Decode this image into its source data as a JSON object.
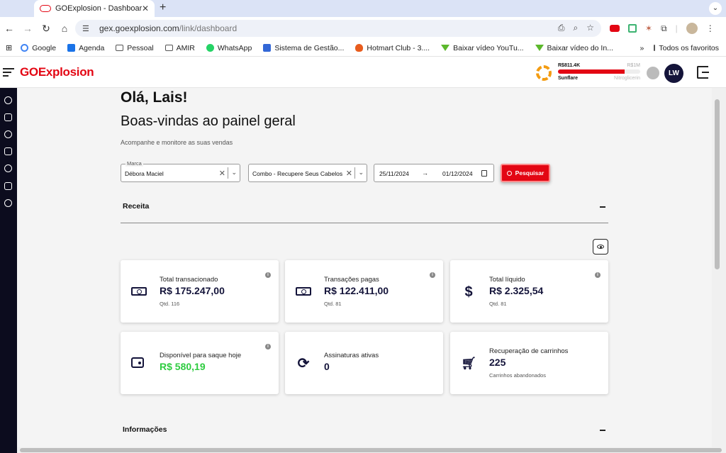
{
  "browser": {
    "tab_title": "GOExplosion - Dashboard",
    "url_host": "gex.goexplosion.com",
    "url_path": "/link/dashboard",
    "bookmarks": [
      "Google",
      "Agenda",
      "Pessoal",
      "AMIR",
      "WhatsApp",
      "Sistema de Gestão...",
      "Hotmart Club - 3....",
      "Baixar vídeo YouTu...",
      "Baixar vídeo do In..."
    ],
    "bookmarks_more": "»",
    "all_favorites": "Todos os favoritos"
  },
  "header": {
    "logo": "GOExplosion",
    "level_current_amount": "R$811.4K",
    "level_target_amount": "R$1M",
    "level_current_name": "Sunflare",
    "level_next_name": "Nitroglicerin",
    "level_progress": 0.81,
    "avatar_initials": "LW"
  },
  "page": {
    "greeting": "Olá, Lais!",
    "welcome": "Boas-vindas ao painel geral",
    "subtitle": "Acompanhe e monitore as suas vendas"
  },
  "filters": {
    "brand_label": "Marca",
    "brand_value": "Débora Maciel",
    "product_value": "Combo - Recupere Seus Cabelos",
    "date_start": "25/11/2024",
    "date_end": "01/12/2024",
    "search_label": "Pesquisar"
  },
  "sections": {
    "revenue": "Receita",
    "info": "Informações"
  },
  "cards": [
    {
      "title": "Total transacionado",
      "value": "R$ 175.247,00",
      "sub": "Qtd. 116"
    },
    {
      "title": "Transações pagas",
      "value": "R$ 122.411,00",
      "sub": "Qtd. 81"
    },
    {
      "title": "Total líquido",
      "value": "R$ 2.325,54",
      "sub": "Qtd. 81"
    },
    {
      "title": "Disponível para saque hoje",
      "value": "R$ 580,19",
      "sub": ""
    },
    {
      "title": "Assinaturas ativas",
      "value": "0",
      "sub": ""
    },
    {
      "title": "Recuperação de carrinhos",
      "value": "225",
      "sub": "Carrinhos abandonados"
    }
  ],
  "colors": {
    "brand": "#e30613",
    "dark": "#14143a",
    "positive": "#2ecc40"
  }
}
